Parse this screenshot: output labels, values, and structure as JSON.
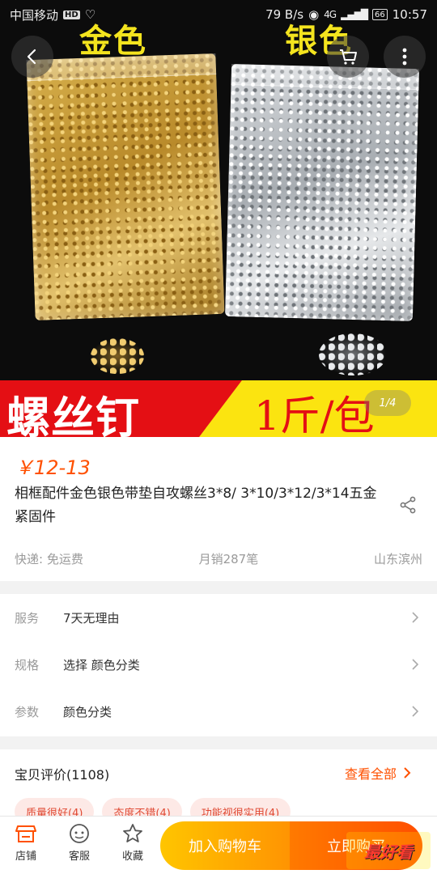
{
  "status_bar": {
    "carrier": "中国移动",
    "hd": "HD",
    "speed": "79 B/s",
    "network": "4G",
    "battery": "66",
    "time": "10:57"
  },
  "gallery": {
    "label_gold": "金色",
    "label_silver": "银色",
    "banner_title": "螺丝钉",
    "banner_sub": "1斤/包",
    "page_indicator": "1/4"
  },
  "product": {
    "price": "￥12-13",
    "title": "相框配件金色银色带垫自攻螺丝3*8/ 3*10/3*12/3*14五金紧固件",
    "shipping": "快递: 免运费",
    "monthly_sales": "月销287笔",
    "location": "山东滨州"
  },
  "options": [
    {
      "label": "服务",
      "value": "7天无理由"
    },
    {
      "label": "规格",
      "value": "选择 颜色分类"
    },
    {
      "label": "参数",
      "value": "颜色分类"
    }
  ],
  "reviews": {
    "title": "宝贝评价(1108)",
    "view_all": "查看全部",
    "tags": [
      "质量很好(4)",
      "态度不错(4)",
      "功能视很实用(4)"
    ]
  },
  "bottom_bar": {
    "shop": "店铺",
    "service": "客服",
    "favorite": "收藏",
    "add_to_cart": "加入购物车",
    "buy_now": "立即购买"
  },
  "watermark": "最好看",
  "colors": {
    "accent": "#ff5000",
    "banner_red": "#e40f14",
    "banner_yellow": "#fbe410",
    "cart_gradient_start": "#ffc500",
    "buy_gradient_end": "#ff4e00"
  }
}
